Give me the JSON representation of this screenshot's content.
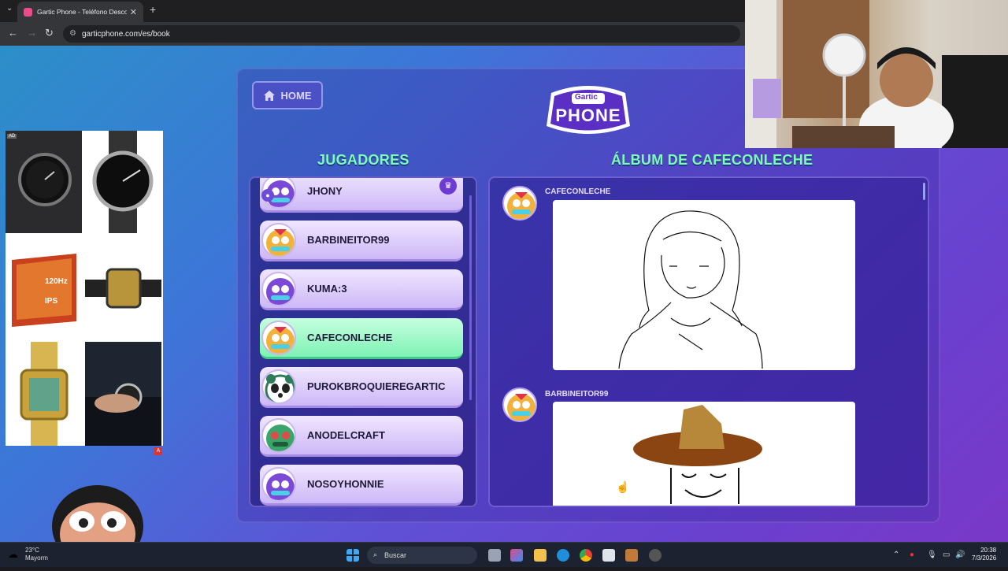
{
  "browser": {
    "tab_title": "Gartic Phone - Teléfono Descon",
    "tab_close": "✕",
    "new_tab": "+",
    "url": "garticphone.com/es/book"
  },
  "page": {
    "home_label": "HOME",
    "logo_top": "Gartic",
    "logo_bottom": "PHONE",
    "players_title": "JUGADORES",
    "album_title": "ÁLBUM DE CAFECONLECHE",
    "players": [
      {
        "name": "JHONY",
        "color": "#7b48d8"
      },
      {
        "name": "BARBINEITOR99",
        "color": "#f2b13b"
      },
      {
        "name": "KUMA:3",
        "color": "#7b48d8"
      },
      {
        "name": "CAFECONLECHE",
        "color": "#f2b13b"
      },
      {
        "name": "PUROKBROQUIEREGARTIC",
        "color": "#2e7c5a"
      },
      {
        "name": "ANODELCRAFT",
        "color": "#3aa46a"
      },
      {
        "name": "NOSOYHONNIE",
        "color": "#7b48d8"
      }
    ],
    "album_entries": [
      {
        "author": "CAFECONLECHE"
      },
      {
        "author": "BARBINEITOR99"
      }
    ],
    "ad_label": "AD",
    "ad_badge": "A"
  },
  "taskbar": {
    "temp": "23°C",
    "weather": "Mayorm",
    "search_placeholder": "Buscar",
    "time": "20:38",
    "date": "7/3/2026"
  }
}
